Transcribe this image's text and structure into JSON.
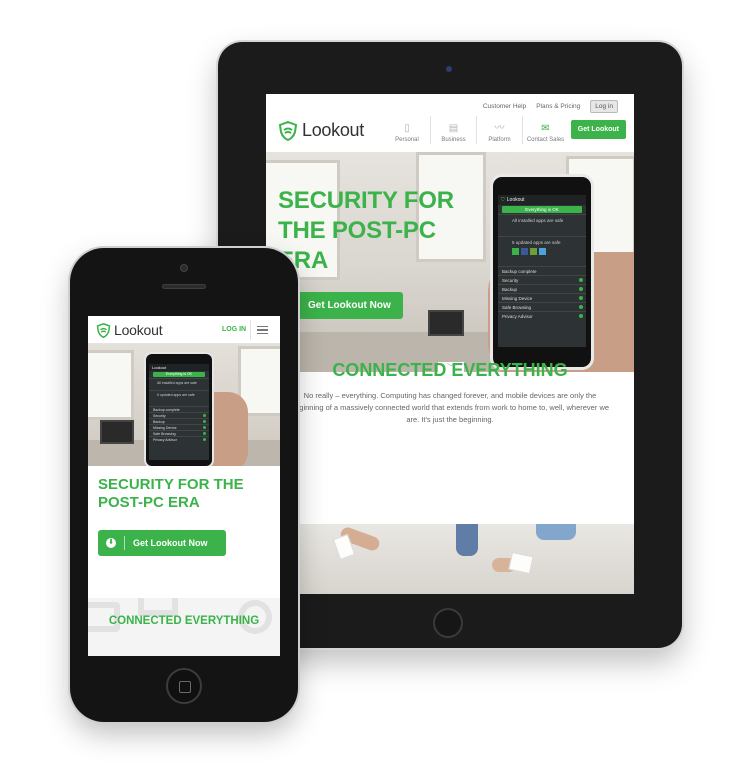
{
  "brand": {
    "name": "Lookout",
    "accent": "#3bb34a"
  },
  "tablet": {
    "topbar": {
      "customer_help": "Customer Help",
      "plans_pricing": "Plans & Pricing",
      "login": "Log in"
    },
    "nav": [
      {
        "label": "Personal",
        "icon": "phone-icon"
      },
      {
        "label": "Business",
        "icon": "briefcase-icon"
      },
      {
        "label": "Platform",
        "icon": "pulse-icon"
      },
      {
        "label": "Contact Sales",
        "icon": "envelope-icon"
      }
    ],
    "cta": "Get Lookout",
    "hero": {
      "title": "Security for the Post-PC Era",
      "button": "Get Lookout Now"
    },
    "app_screen": {
      "header": "Lookout",
      "status": "Everything is OK",
      "card1": "All installed apps are safe",
      "card2": "5 updated apps are safe",
      "card3": "Backup complete",
      "rows": [
        "Security",
        "Backup",
        "Missing Device",
        "Safe Browsing",
        "Privacy Advisor"
      ]
    },
    "section": {
      "title": "Connected Everything",
      "body": "No really – everything. Computing has changed forever, and mobile devices are only the beginning of a massively connected world that extends from work to home to, well, wherever we are. It's just the beginning."
    }
  },
  "phone": {
    "login": "LOG IN",
    "hero_title": "Security for the Post-PC Era",
    "button": "Get Lookout Now",
    "section_title": "Connected Everything",
    "app_screen": {
      "header": "Lookout",
      "status": "Everything is OK",
      "card1": "All installed apps are safe",
      "card2": "5 updated apps are safe",
      "card3": "Backup complete",
      "rows": [
        "Security",
        "Backup",
        "Missing Device",
        "Safe Browsing",
        "Privacy Advisor"
      ]
    }
  }
}
